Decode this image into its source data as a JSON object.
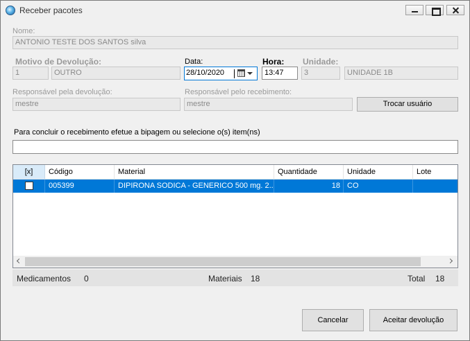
{
  "window": {
    "title": "Receber pacotes"
  },
  "nome": {
    "label": "Nome:",
    "value": "ANTONIO TESTE DOS SANTOS silva"
  },
  "motivo": {
    "label": "Motivo de Devolução:",
    "code": "1",
    "value": "OUTRO"
  },
  "data": {
    "label": "Data:",
    "value": "28/10/2020"
  },
  "hora": {
    "label": "Hora:",
    "value": "13:47"
  },
  "unidade": {
    "label": "Unidade:",
    "code": "3",
    "value": "UNIDADE 1B"
  },
  "resp_devolucao": {
    "label": "Responsável pela devolução:",
    "value": "mestre"
  },
  "resp_recebimento": {
    "label": "Responsável pelo recebimento:",
    "value": "mestre"
  },
  "trocar_usuario": {
    "label": "Trocar usuário"
  },
  "scan": {
    "label": "Para concluir o recebimento efetue a bipagem ou selecione o(s) item(ns)",
    "value": ""
  },
  "grid": {
    "headers": [
      "[x]",
      "Código",
      "Material",
      "Quantidade",
      "Unidade",
      "Lote"
    ],
    "rows": [
      {
        "checked": false,
        "codigo": "005399",
        "material": "DIPIRONA SODICA - GENERICO 500 mg. 2...",
        "quantidade": "18",
        "unidade": "CO",
        "lote": ""
      }
    ]
  },
  "totals": {
    "medicamentos_label": "Medicamentos",
    "medicamentos_value": "0",
    "materiais_label": "Materiais",
    "materiais_value": "18",
    "total_label": "Total",
    "total_value": "18"
  },
  "actions": {
    "cancel": "Cancelar",
    "accept": "Aceitar devolução"
  },
  "colors": {
    "selection": "#0078d7",
    "focus_border": "#0078d7",
    "window_bg": "#f0f0f0"
  }
}
